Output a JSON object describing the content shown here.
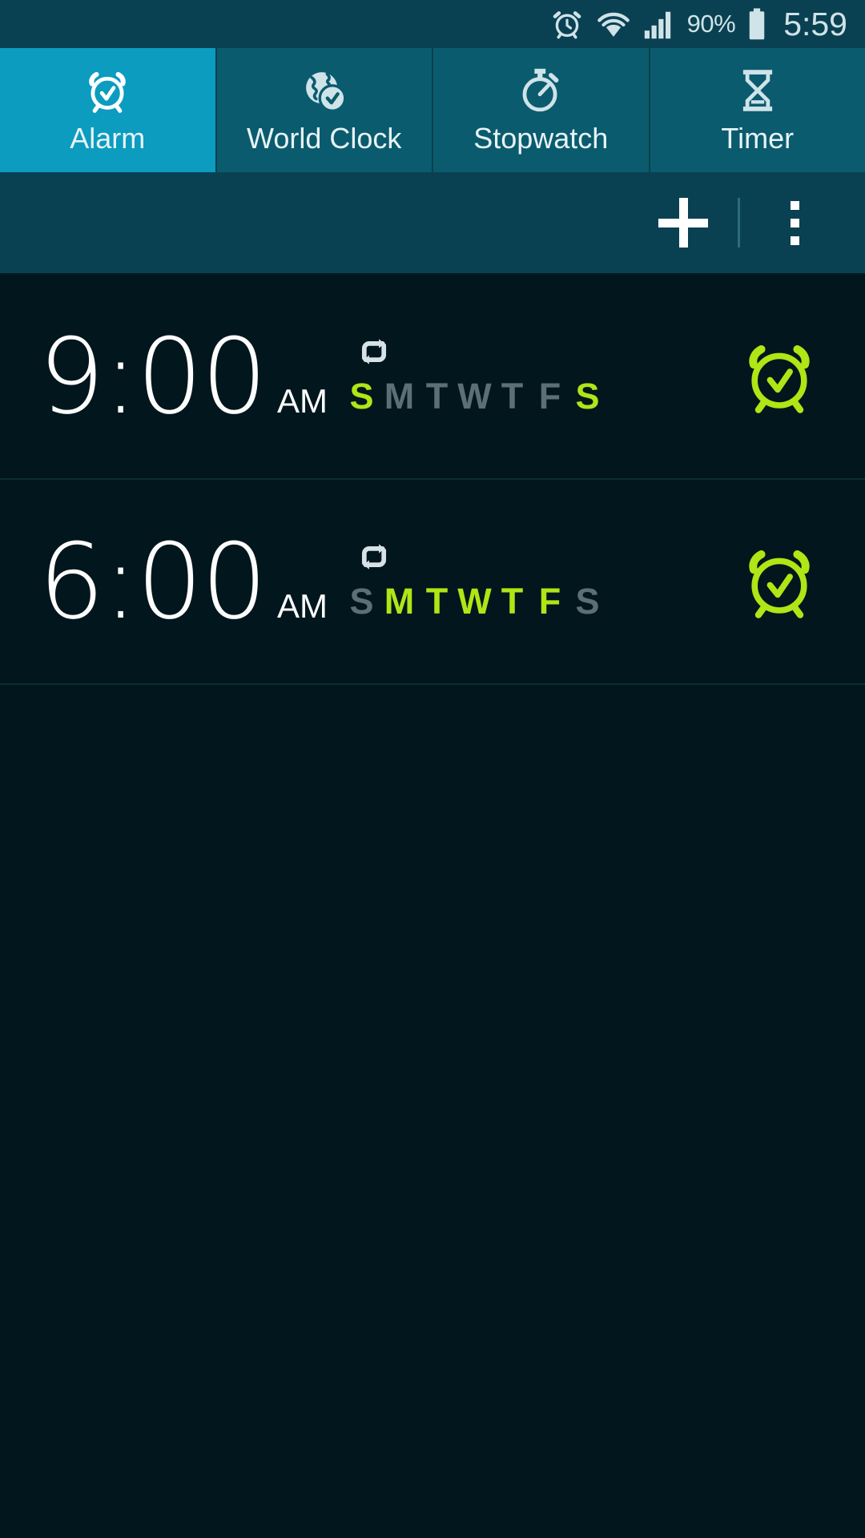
{
  "status_bar": {
    "alarm_icon": "alarm-clock-icon",
    "wifi_icon": "wifi-icon",
    "signal_icon": "cellular-signal-icon",
    "battery_percent": "90%",
    "battery_icon": "battery-icon",
    "time": "5:59"
  },
  "tabs": [
    {
      "label": "Alarm",
      "icon": "alarm-clock-icon",
      "active": true
    },
    {
      "label": "World Clock",
      "icon": "globe-clock-icon",
      "active": false
    },
    {
      "label": "Stopwatch",
      "icon": "stopwatch-icon",
      "active": false
    },
    {
      "label": "Timer",
      "icon": "hourglass-icon",
      "active": false
    }
  ],
  "action_bar": {
    "add_label": "+",
    "add_icon": "plus-icon",
    "overflow_icon": "more-vertical-icon"
  },
  "alarms": [
    {
      "time": "9:00",
      "meridiem": "AM",
      "repeat_icon": "repeat-icon",
      "enabled": true,
      "toggle_icon": "alarm-bell-icon",
      "days": [
        {
          "letter": "S",
          "active": true
        },
        {
          "letter": "M",
          "active": false
        },
        {
          "letter": "T",
          "active": false
        },
        {
          "letter": "W",
          "active": false
        },
        {
          "letter": "T",
          "active": false
        },
        {
          "letter": "F",
          "active": false
        },
        {
          "letter": "S",
          "active": true
        }
      ]
    },
    {
      "time": "6:00",
      "meridiem": "AM",
      "repeat_icon": "repeat-icon",
      "enabled": true,
      "toggle_icon": "alarm-bell-icon",
      "days": [
        {
          "letter": "S",
          "active": false
        },
        {
          "letter": "M",
          "active": true
        },
        {
          "letter": "T",
          "active": true
        },
        {
          "letter": "W",
          "active": true
        },
        {
          "letter": "T",
          "active": true
        },
        {
          "letter": "F",
          "active": true
        },
        {
          "letter": "S",
          "active": false
        }
      ]
    }
  ],
  "colors": {
    "status_bar_bg": "#0a4152",
    "tab_bg": "#0a5b6e",
    "tab_active_bg": "#0b9cc0",
    "action_bar_bg": "#0a4152",
    "list_bg": "#02161d",
    "accent_green": "#b0e516",
    "day_inactive": "#5c6f76",
    "text_light": "#fdfdfd"
  }
}
